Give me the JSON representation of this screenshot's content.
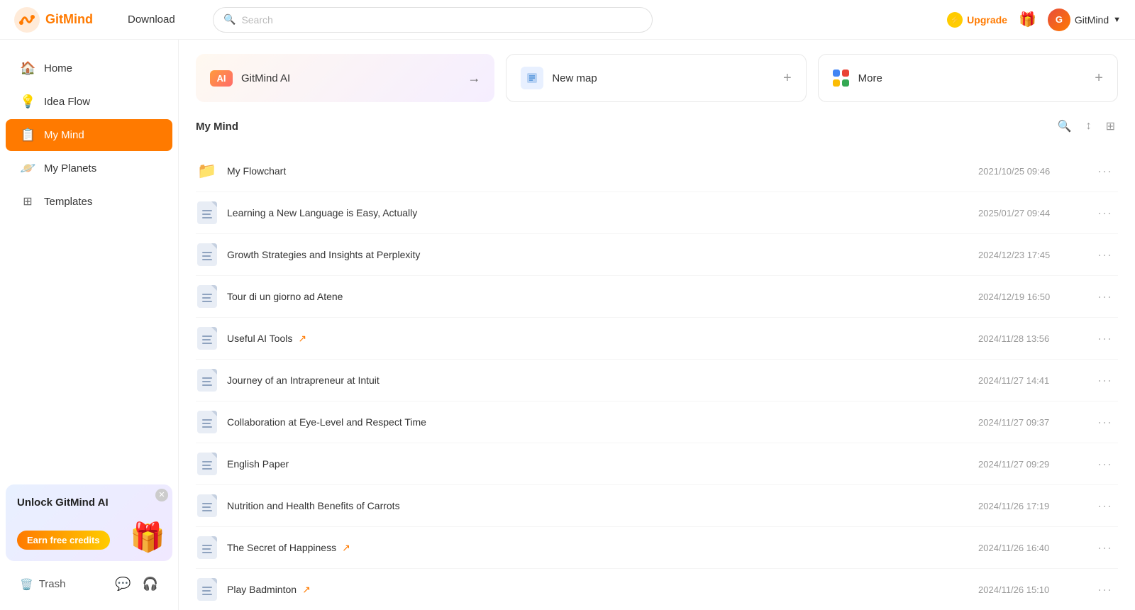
{
  "topbar": {
    "logo_text": "GitMind",
    "download_label": "Download",
    "search_placeholder": "Search",
    "upgrade_label": "Upgrade",
    "user_name": "GitMind"
  },
  "sidebar": {
    "items": [
      {
        "id": "home",
        "label": "Home",
        "icon": "🏠"
      },
      {
        "id": "idea-flow",
        "label": "Idea Flow",
        "icon": "💡"
      },
      {
        "id": "my-mind",
        "label": "My Mind",
        "icon": "📋",
        "active": true
      },
      {
        "id": "my-planets",
        "label": "My Planets",
        "icon": "🪐"
      },
      {
        "id": "templates",
        "label": "Templates",
        "icon": "⊞"
      }
    ],
    "promo": {
      "title": "Unlock GitMind AI",
      "button_label": "Earn free credits"
    },
    "trash_label": "Trash"
  },
  "quick_actions": [
    {
      "id": "ai",
      "label": "GitMind AI",
      "badge": "AI",
      "type": "ai"
    },
    {
      "id": "new-map",
      "label": "New map",
      "type": "new"
    },
    {
      "id": "more",
      "label": "More",
      "type": "more"
    }
  ],
  "section": {
    "title": "My Mind"
  },
  "files": [
    {
      "id": 1,
      "name": "My Flowchart",
      "date": "2021/10/25 09:46",
      "type": "folder",
      "shared": false
    },
    {
      "id": 2,
      "name": "Learning a New Language is Easy, Actually",
      "date": "2025/01/27 09:44",
      "type": "doc",
      "shared": false
    },
    {
      "id": 3,
      "name": "Growth Strategies and Insights at Perplexity",
      "date": "2024/12/23 17:45",
      "type": "doc",
      "shared": false
    },
    {
      "id": 4,
      "name": "Tour di un giorno ad Atene",
      "date": "2024/12/19 16:50",
      "type": "doc",
      "shared": false
    },
    {
      "id": 5,
      "name": "Useful AI Tools",
      "date": "2024/11/28 13:56",
      "type": "doc",
      "shared": true
    },
    {
      "id": 6,
      "name": "Journey of an Intrapreneur at Intuit",
      "date": "2024/11/27 14:41",
      "type": "doc",
      "shared": false
    },
    {
      "id": 7,
      "name": "Collaboration at Eye-Level and Respect Time",
      "date": "2024/11/27 09:37",
      "type": "doc",
      "shared": false
    },
    {
      "id": 8,
      "name": "English Paper",
      "date": "2024/11/27 09:29",
      "type": "doc",
      "shared": false
    },
    {
      "id": 9,
      "name": "Nutrition and Health Benefits of Carrots",
      "date": "2024/11/26 17:19",
      "type": "doc",
      "shared": false
    },
    {
      "id": 10,
      "name": "The Secret of Happiness",
      "date": "2024/11/26 16:40",
      "type": "doc",
      "shared": true
    },
    {
      "id": 11,
      "name": "Play Badminton",
      "date": "2024/11/26 15:10",
      "type": "doc",
      "shared": true
    }
  ],
  "colors": {
    "accent": "#ff7a00",
    "active_nav": "#ff7a00",
    "folder": "#f5a623",
    "more_colors": [
      "#4285F4",
      "#EA4335",
      "#FBBC05",
      "#34A853"
    ]
  }
}
